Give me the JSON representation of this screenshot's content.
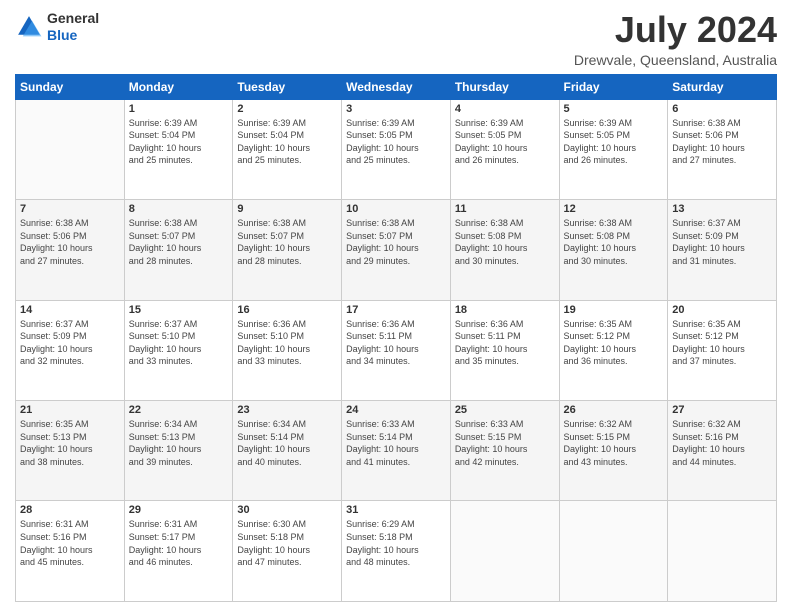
{
  "logo": {
    "line1": "General",
    "line2": "Blue"
  },
  "title": "July 2024",
  "subtitle": "Drewvale, Queensland, Australia",
  "days": [
    "Sunday",
    "Monday",
    "Tuesday",
    "Wednesday",
    "Thursday",
    "Friday",
    "Saturday"
  ],
  "weeks": [
    [
      {
        "day": "",
        "info": ""
      },
      {
        "day": "1",
        "info": "Sunrise: 6:39 AM\nSunset: 5:04 PM\nDaylight: 10 hours\nand 25 minutes."
      },
      {
        "day": "2",
        "info": "Sunrise: 6:39 AM\nSunset: 5:04 PM\nDaylight: 10 hours\nand 25 minutes."
      },
      {
        "day": "3",
        "info": "Sunrise: 6:39 AM\nSunset: 5:05 PM\nDaylight: 10 hours\nand 25 minutes."
      },
      {
        "day": "4",
        "info": "Sunrise: 6:39 AM\nSunset: 5:05 PM\nDaylight: 10 hours\nand 26 minutes."
      },
      {
        "day": "5",
        "info": "Sunrise: 6:39 AM\nSunset: 5:05 PM\nDaylight: 10 hours\nand 26 minutes."
      },
      {
        "day": "6",
        "info": "Sunrise: 6:38 AM\nSunset: 5:06 PM\nDaylight: 10 hours\nand 27 minutes."
      }
    ],
    [
      {
        "day": "7",
        "info": "Sunrise: 6:38 AM\nSunset: 5:06 PM\nDaylight: 10 hours\nand 27 minutes."
      },
      {
        "day": "8",
        "info": "Sunrise: 6:38 AM\nSunset: 5:07 PM\nDaylight: 10 hours\nand 28 minutes."
      },
      {
        "day": "9",
        "info": "Sunrise: 6:38 AM\nSunset: 5:07 PM\nDaylight: 10 hours\nand 28 minutes."
      },
      {
        "day": "10",
        "info": "Sunrise: 6:38 AM\nSunset: 5:07 PM\nDaylight: 10 hours\nand 29 minutes."
      },
      {
        "day": "11",
        "info": "Sunrise: 6:38 AM\nSunset: 5:08 PM\nDaylight: 10 hours\nand 30 minutes."
      },
      {
        "day": "12",
        "info": "Sunrise: 6:38 AM\nSunset: 5:08 PM\nDaylight: 10 hours\nand 30 minutes."
      },
      {
        "day": "13",
        "info": "Sunrise: 6:37 AM\nSunset: 5:09 PM\nDaylight: 10 hours\nand 31 minutes."
      }
    ],
    [
      {
        "day": "14",
        "info": "Sunrise: 6:37 AM\nSunset: 5:09 PM\nDaylight: 10 hours\nand 32 minutes."
      },
      {
        "day": "15",
        "info": "Sunrise: 6:37 AM\nSunset: 5:10 PM\nDaylight: 10 hours\nand 33 minutes."
      },
      {
        "day": "16",
        "info": "Sunrise: 6:36 AM\nSunset: 5:10 PM\nDaylight: 10 hours\nand 33 minutes."
      },
      {
        "day": "17",
        "info": "Sunrise: 6:36 AM\nSunset: 5:11 PM\nDaylight: 10 hours\nand 34 minutes."
      },
      {
        "day": "18",
        "info": "Sunrise: 6:36 AM\nSunset: 5:11 PM\nDaylight: 10 hours\nand 35 minutes."
      },
      {
        "day": "19",
        "info": "Sunrise: 6:35 AM\nSunset: 5:12 PM\nDaylight: 10 hours\nand 36 minutes."
      },
      {
        "day": "20",
        "info": "Sunrise: 6:35 AM\nSunset: 5:12 PM\nDaylight: 10 hours\nand 37 minutes."
      }
    ],
    [
      {
        "day": "21",
        "info": "Sunrise: 6:35 AM\nSunset: 5:13 PM\nDaylight: 10 hours\nand 38 minutes."
      },
      {
        "day": "22",
        "info": "Sunrise: 6:34 AM\nSunset: 5:13 PM\nDaylight: 10 hours\nand 39 minutes."
      },
      {
        "day": "23",
        "info": "Sunrise: 6:34 AM\nSunset: 5:14 PM\nDaylight: 10 hours\nand 40 minutes."
      },
      {
        "day": "24",
        "info": "Sunrise: 6:33 AM\nSunset: 5:14 PM\nDaylight: 10 hours\nand 41 minutes."
      },
      {
        "day": "25",
        "info": "Sunrise: 6:33 AM\nSunset: 5:15 PM\nDaylight: 10 hours\nand 42 minutes."
      },
      {
        "day": "26",
        "info": "Sunrise: 6:32 AM\nSunset: 5:15 PM\nDaylight: 10 hours\nand 43 minutes."
      },
      {
        "day": "27",
        "info": "Sunrise: 6:32 AM\nSunset: 5:16 PM\nDaylight: 10 hours\nand 44 minutes."
      }
    ],
    [
      {
        "day": "28",
        "info": "Sunrise: 6:31 AM\nSunset: 5:16 PM\nDaylight: 10 hours\nand 45 minutes."
      },
      {
        "day": "29",
        "info": "Sunrise: 6:31 AM\nSunset: 5:17 PM\nDaylight: 10 hours\nand 46 minutes."
      },
      {
        "day": "30",
        "info": "Sunrise: 6:30 AM\nSunset: 5:18 PM\nDaylight: 10 hours\nand 47 minutes."
      },
      {
        "day": "31",
        "info": "Sunrise: 6:29 AM\nSunset: 5:18 PM\nDaylight: 10 hours\nand 48 minutes."
      },
      {
        "day": "",
        "info": ""
      },
      {
        "day": "",
        "info": ""
      },
      {
        "day": "",
        "info": ""
      }
    ]
  ]
}
